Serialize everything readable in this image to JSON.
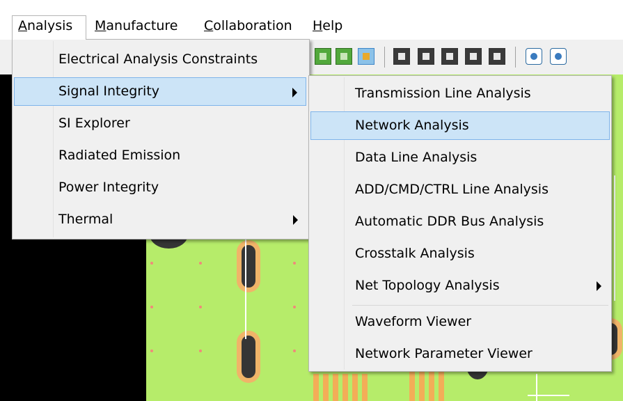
{
  "menubar": {
    "items": [
      "Analysis",
      "Manufacture",
      "Collaboration",
      "Help"
    ],
    "mnemonics": [
      "A",
      "M",
      "C",
      "H"
    ],
    "rest": [
      "nalysis",
      "anufacture",
      "ollaboration",
      "elp"
    ],
    "open_item": "Analysis"
  },
  "analysis_menu": {
    "items": [
      {
        "label": "Electrical Analysis Constraints",
        "submenu": false
      },
      {
        "label": "Signal Integrity",
        "submenu": true,
        "highlighted": true
      },
      {
        "label": "SI Explorer",
        "submenu": false
      },
      {
        "label": "Radiated Emission",
        "submenu": false
      },
      {
        "label": "Power Integrity",
        "submenu": false
      },
      {
        "label": "Thermal",
        "submenu": true
      }
    ]
  },
  "signal_integrity_menu": {
    "items": [
      {
        "label": "Transmission Line Analysis",
        "submenu": false
      },
      {
        "label": "Network Analysis",
        "submenu": false,
        "highlighted": true
      },
      {
        "label": "Data Line Analysis",
        "submenu": false
      },
      {
        "label": "ADD/CMD/CTRL Line Analysis",
        "submenu": false
      },
      {
        "label": "Automatic DDR Bus Analysis",
        "submenu": false
      },
      {
        "label": "Crosstalk Analysis",
        "submenu": false
      },
      {
        "label": "Net Topology Analysis",
        "submenu": true
      },
      {
        "label": "Waveform Viewer",
        "submenu": false
      },
      {
        "label": "Network Parameter Viewer",
        "submenu": false
      }
    ]
  },
  "colors": {
    "highlight_bg": "#cce4f7",
    "highlight_border": "#7eb4ea",
    "board": "#b6ec6a",
    "pad_ring": "#f0b469"
  }
}
